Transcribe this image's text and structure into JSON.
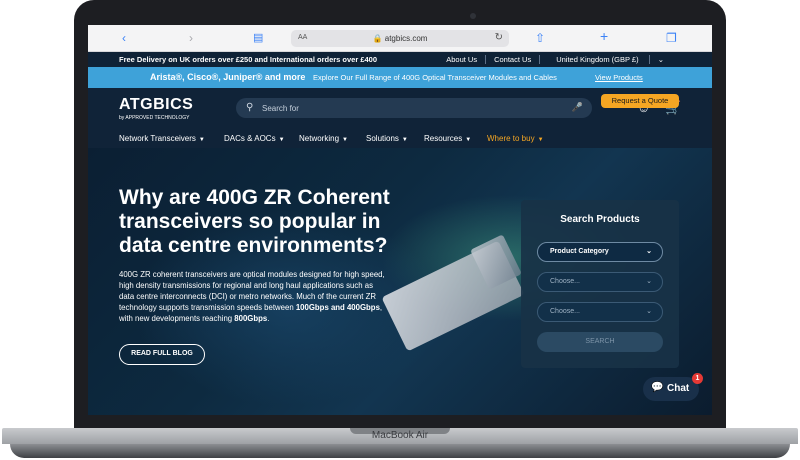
{
  "device": {
    "model": "MacBook Air"
  },
  "browser": {
    "aa": "AA",
    "url": "atgbics.com",
    "icons": [
      "back-icon",
      "forward-icon",
      "book-icon",
      "lock-icon",
      "reload-icon",
      "share-icon",
      "new-tab-icon",
      "tabs-icon"
    ]
  },
  "topbar": {
    "message": "Free Delivery on UK orders over £250 and International orders over £400",
    "links": [
      "About Us",
      "Contact Us",
      "United Kingdom (GBP £)"
    ]
  },
  "promo": {
    "brands": "Arista®, Cisco®, Juniper® and more",
    "text": "Explore Our Full Range of 400G Optical Transceiver Modules and Cables",
    "link": "View Products"
  },
  "header": {
    "logo_word": "ATGBICS",
    "logo_sub": "by APPROVED TECHNOLOGY",
    "search_placeholder": "Search for",
    "nav": [
      "Network Transceivers",
      "DACs & AOCs",
      "Networking",
      "Solutions",
      "Resources",
      "Where to buy"
    ],
    "quote_label": "Request a Quote",
    "accent": "#f5a623"
  },
  "hero": {
    "title": "Why are 400G ZR Coherent transceivers so popular in data centre environments?",
    "desc_1": "400G ZR coherent transceivers are optical modules designed for high speed, high density transmissions for regional and long haul applications such as data centre interconnects (DCI) or metro networks. Much of the current ZR technology supports transmission speeds between ",
    "desc_b1": "100Gbps and 400Gbps",
    "desc_2": ", with new developments reaching ",
    "desc_b2": "800Gbps",
    "desc_3": ".",
    "button": "READ FULL BLOG"
  },
  "search_panel": {
    "title": "Search Products",
    "select_1": "Product Category",
    "select_2": "Choose...",
    "select_3": "Choose...",
    "button": "SEARCH"
  },
  "chat": {
    "label": "Chat",
    "badge": "1"
  }
}
